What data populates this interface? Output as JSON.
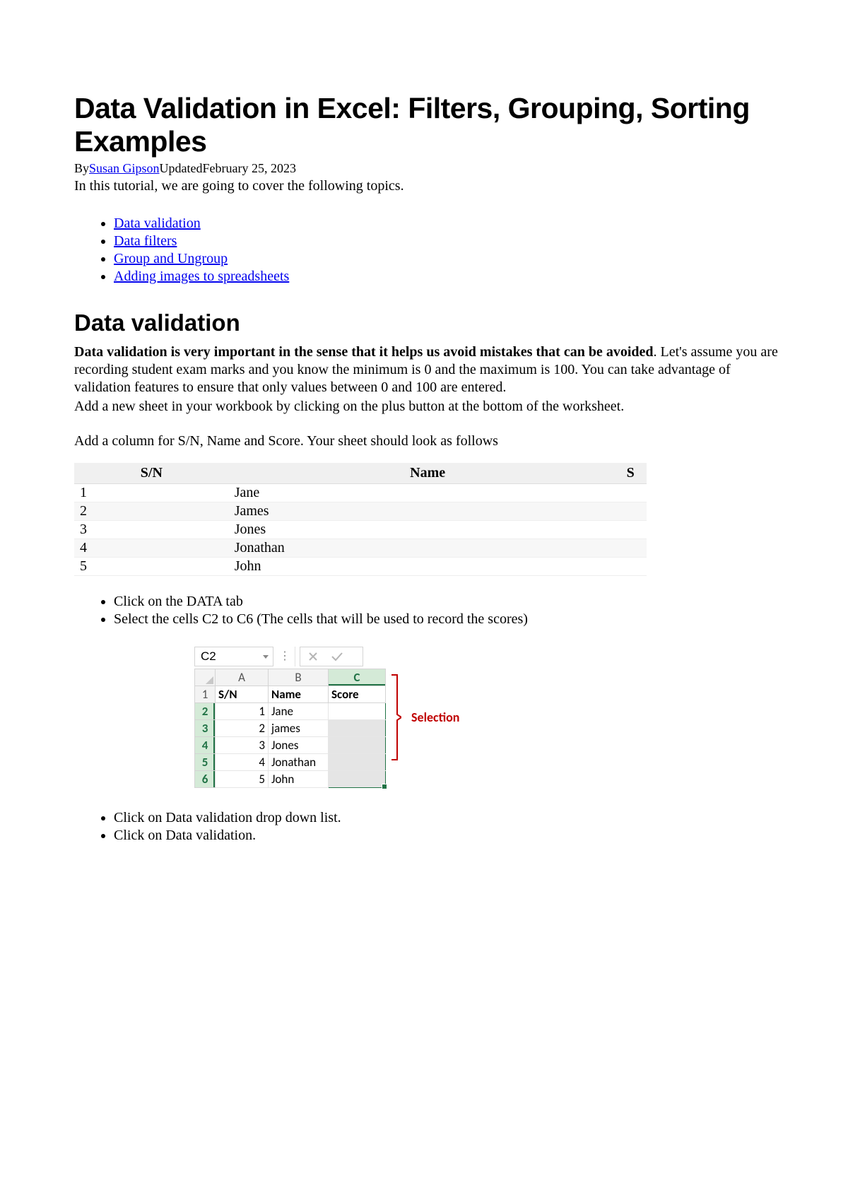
{
  "title": "Data Validation in Excel: Filters, Grouping, Sorting Examples",
  "byline": {
    "by": "By",
    "author": "Susan Gipson",
    "updated_label": "Updated",
    "updated_date": "February 25, 2023"
  },
  "intro": "In this tutorial, we are going to cover the following topics.",
  "toc": {
    "item0": "Data validation",
    "item1": "Data filters",
    "item2": "Group and Ungroup",
    "item3": "Adding images to spreadsheets"
  },
  "section1_heading": "Data validation",
  "para1_bold": "Data validation is very important in the sense that it helps us avoid mistakes that can be avoided",
  "para1_rest": ". Let's assume you are recording student exam marks and you know the minimum is 0 and the maximum is 100. You can take advantage of validation features to ensure that only values between 0 and 100 are entered.",
  "para2": "Add a new sheet in your workbook by clicking on the plus button at the bottom of the worksheet.",
  "para3": "Add a column for S/N, Name and Score. Your sheet should look as follows",
  "table_headers": {
    "sn": "S/N",
    "name": "Name",
    "score": "S"
  },
  "table_rows": {
    "r0": {
      "sn": "1",
      "name": "Jane"
    },
    "r1": {
      "sn": "2",
      "name": "James"
    },
    "r2": {
      "sn": "3",
      "name": "Jones"
    },
    "r3": {
      "sn": "4",
      "name": "Jonathan"
    },
    "r4": {
      "sn": "5",
      "name": "John"
    }
  },
  "steps1": {
    "s0": "Click on the DATA tab",
    "s1": "Select the cells C2 to C6 (The cells that will be used to record the scores)"
  },
  "excel": {
    "name_box": "C2",
    "cols": {
      "a": "A",
      "b": "B",
      "c": "C"
    },
    "row_labels": {
      "r1": "1",
      "r2": "2",
      "r3": "3",
      "r4": "4",
      "r5": "5",
      "r6": "6"
    },
    "headers": {
      "sn": "S/N",
      "name": "Name",
      "score": "Score"
    },
    "rows": {
      "r2": {
        "sn": "1",
        "name": "Jane"
      },
      "r3": {
        "sn": "2",
        "name": "james"
      },
      "r4": {
        "sn": "3",
        "name": "Jones"
      },
      "r5": {
        "sn": "4",
        "name": "Jonathan"
      },
      "r6": {
        "sn": "5",
        "name": "John"
      }
    },
    "selection_label": "Selection"
  },
  "steps2": {
    "s0": "Click on Data validation drop down list.",
    "s1": "Click on Data validation."
  }
}
